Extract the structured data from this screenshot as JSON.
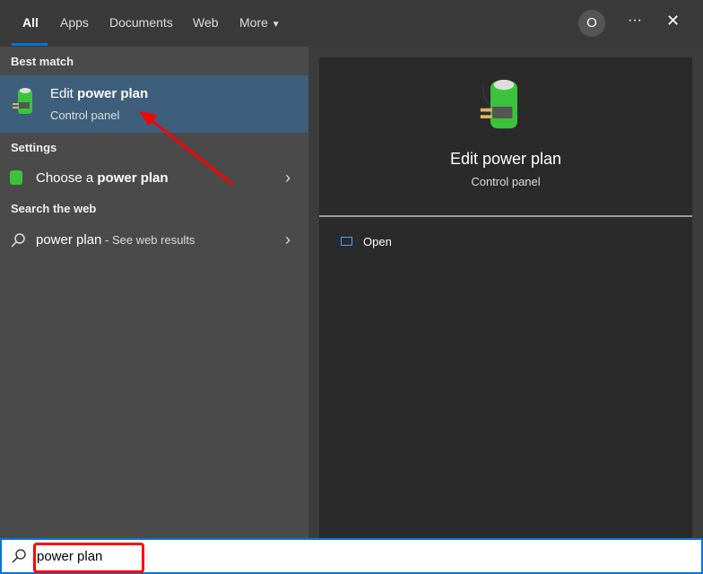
{
  "tabs": [
    "All",
    "Apps",
    "Documents",
    "Web",
    "More"
  ],
  "avatar": "O",
  "more_options": "···",
  "close": "✕",
  "best_match": {
    "header": "Best match",
    "title_pre": "Edit ",
    "title_bold": "power plan",
    "subtitle": "Control panel"
  },
  "settings": {
    "header": "Settings",
    "label_pre": "Choose a ",
    "label_bold": "power plan"
  },
  "web": {
    "header": "Search the web",
    "label": "power plan",
    "suffix": " - See web results"
  },
  "detail": {
    "title": "Edit power plan",
    "subtitle": "Control panel",
    "action": "Open"
  },
  "search": {
    "value": "power plan"
  },
  "colors": {
    "accent": "#0a74d4",
    "selected": "#3e5f7c",
    "annotation": "#ff0000"
  }
}
